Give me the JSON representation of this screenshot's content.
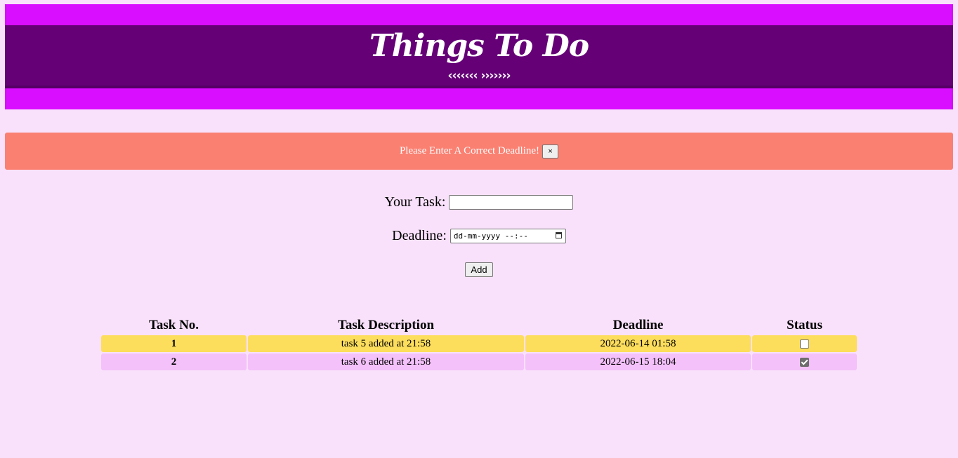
{
  "header": {
    "title": "Things To Do",
    "decoration": "‹‹‹‹‹‹‹ ›››››››"
  },
  "alert": {
    "message": "Please Enter A Correct Deadline!",
    "close_label": "×"
  },
  "form": {
    "task_label": "Your Task:",
    "task_value": "",
    "deadline_label": "Deadline:",
    "deadline_placeholder": "dd-mm-yyyy --:--",
    "add_label": "Add"
  },
  "table": {
    "headers": [
      "Task No.",
      "Task Description",
      "Deadline",
      "Status"
    ],
    "rows": [
      {
        "no": "1",
        "description": "task 5 added at 21:58",
        "deadline": "2022-06-14 01:58",
        "done": false
      },
      {
        "no": "2",
        "description": "task 6 added at 21:58",
        "deadline": "2022-06-15 18:04",
        "done": true
      }
    ]
  },
  "colors": {
    "page_bg": "#f9e1fb",
    "header_outer": "#d90dff",
    "header_band": "#650077",
    "alert_bg": "#fa8072",
    "row_odd": "#fddd5c",
    "row_even": "#f4c1fa"
  }
}
